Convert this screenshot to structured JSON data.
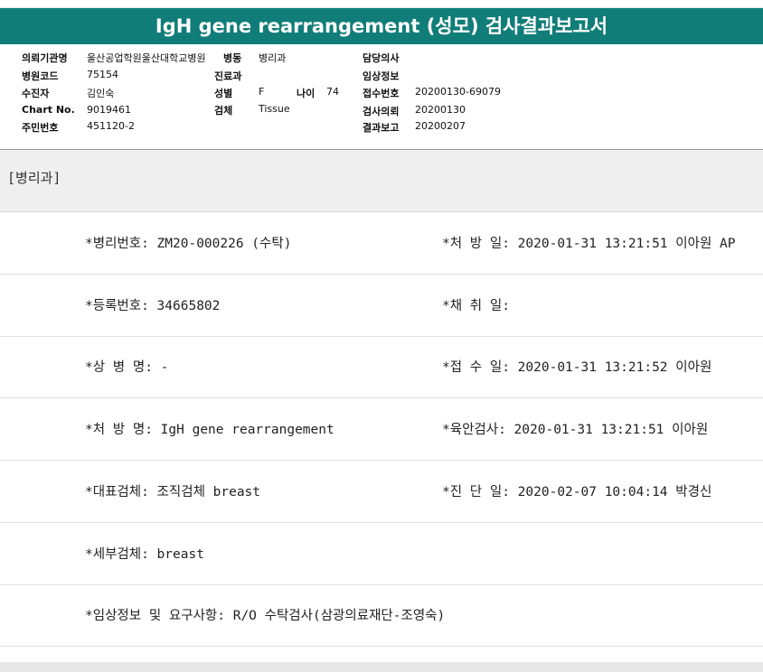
{
  "report": {
    "title": "IgH gene rearrangement (성모) 검사결과보고서"
  },
  "header": {
    "institution_label": "의뢰기관명",
    "institution_value": "울산공업학원울산대학교병원",
    "ward_label": "병동",
    "ward_value": "병리과",
    "attending_label": "담당의사",
    "attending_value": "",
    "hospital_code_label": "병원코드",
    "hospital_code_value": "75154",
    "department_label": "진료과",
    "department_value": "",
    "clinical_info_label": "임상정보",
    "clinical_info_value": "",
    "patient_label": "수진자",
    "patient_value": "김인숙",
    "sex_label": "성별",
    "sex_value": "F",
    "age_label": "나이",
    "age_value": "74",
    "receipt_no_label": "접수번호",
    "receipt_no_value": "20200130-69079",
    "chart_no_label": "Chart No.",
    "chart_no_value": "9019461",
    "specimen_label": "검체",
    "specimen_value": "Tissue",
    "request_label": "검사의뢰",
    "request_value": "20200130",
    "resident_no_label": "주민번호",
    "resident_no_value": "451120-2",
    "result_report_label": "결과보고",
    "result_report_value": "20200207"
  },
  "section": {
    "label": "[병리과]"
  },
  "rows": [
    {
      "left": "*병리번호: ZM20-000226 (수탁)",
      "right": "*처 방 일: 2020-01-31 13:21:51  이아원 AP"
    },
    {
      "left": "*등록번호: 34665802",
      "right": "*채 취 일:"
    },
    {
      "left": "*상 병 명: -",
      "right": "*접 수 일: 2020-01-31 13:21:52  이아원"
    },
    {
      "left": "*처 방 명: IgH gene rearrangement",
      "right": "*육안검사: 2020-01-31 13:21:51  이아원"
    },
    {
      "left": "*대표검체: 조직검체 breast",
      "right": "*진 단 일: 2020-02-07 10:04:14  박경신"
    },
    {
      "left": "*세부검체: breast",
      "right": ""
    },
    {
      "left": "*임상정보 및 요구사항: R/O 수탁검사(삼광의료재단-조영숙)",
      "right": ""
    }
  ]
}
